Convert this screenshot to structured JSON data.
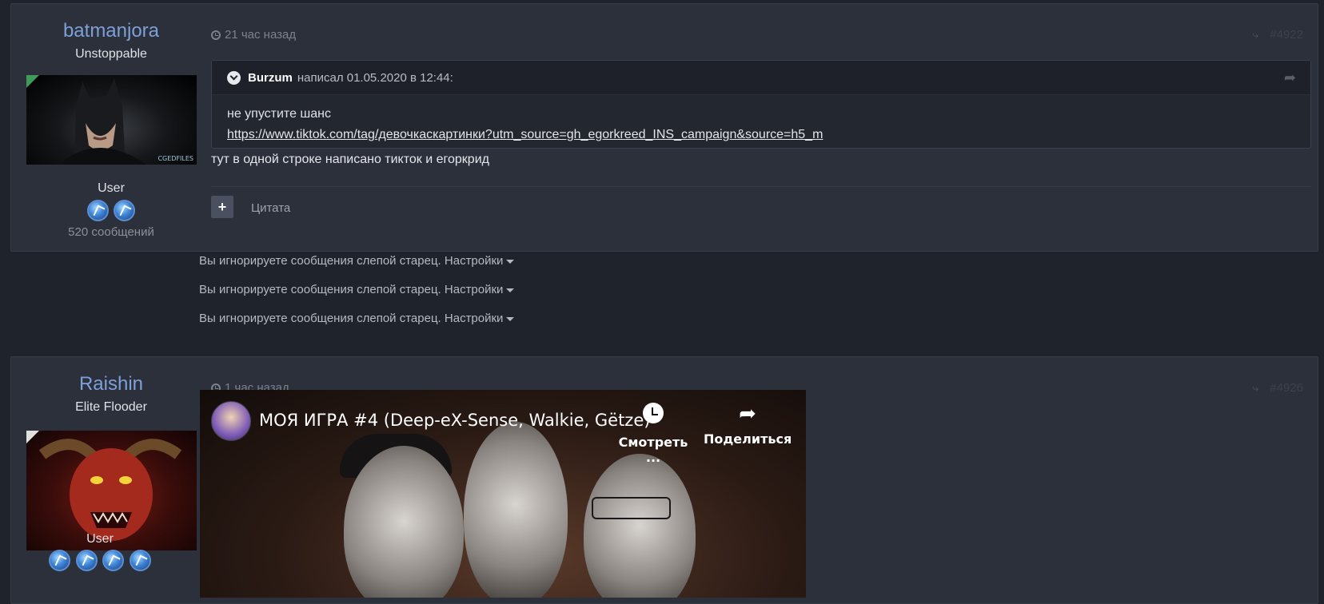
{
  "posts": [
    {
      "username": "batmanjora",
      "user_title": "Unstoppable",
      "group": "User",
      "post_count": "520 сообщений",
      "time": "21 час назад",
      "post_number": "#4922",
      "quote": {
        "author": "Burzum",
        "header_rest": "написал 01.05.2020 в 12:44:",
        "line1": "не упустите шанс",
        "link": "https://www.tiktok.com/tag/девочкаскартинки?utm_source=gh_egorkreed_INS_campaign&source=h5_m"
      },
      "text": "тут в одной строке написано тикток и егоркрид",
      "quote_button": "Цитата",
      "avatar_watermark": "CGEDFILES"
    },
    {
      "username": "Raishin",
      "user_title": "Elite Flooder",
      "group": "User",
      "time": "1 час назад",
      "post_number": "#4926",
      "video": {
        "title": "МОЯ ИГРА #4 (Deep-eX-Sense, Walkie, Gëtze)",
        "watch_label": "Смотреть ...",
        "share_label": "Поделиться"
      }
    }
  ],
  "ignored": [
    {
      "text": "Вы игнорируете сообщения слепой старец.",
      "settings": "Настройки"
    },
    {
      "text": "Вы игнорируете сообщения слепой старец.",
      "settings": "Настройки"
    },
    {
      "text": "Вы игнорируете сообщения слепой старец.",
      "settings": "Настройки"
    }
  ],
  "icons": {
    "share": "share-icon",
    "clock": "clock-icon",
    "quote_chevron": "chevron-down-icon",
    "reply_arrow": "reply-arrow-icon"
  },
  "colors": {
    "username": "#7ea0d8",
    "background": "#1f232b",
    "post_bg": "#2b303b"
  }
}
